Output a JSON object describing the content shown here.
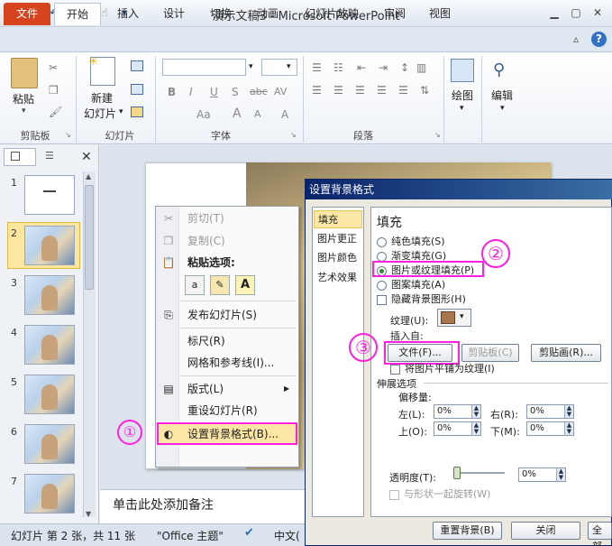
{
  "window": {
    "title": "演示文稿3 - Microsoft PowerPoint",
    "app_icon": "P"
  },
  "tabs": [
    "文件",
    "开始",
    "插入",
    "设计",
    "切换",
    "动画",
    "幻灯片放映",
    "审阅",
    "视图"
  ],
  "ribbon": {
    "groups": {
      "clipboard": "剪贴板",
      "slides": "幻灯片",
      "font": "字体",
      "paragraph": "段落"
    },
    "buttons": {
      "paste": "粘贴",
      "new_slide_1": "新建",
      "new_slide_2": "幻灯片",
      "drawing": "绘图",
      "edit": "编辑"
    },
    "font_formats": [
      "B",
      "I",
      "U",
      "S",
      "abc",
      "AV",
      "Aa",
      "A",
      "A"
    ]
  },
  "thumbnails": [
    "1",
    "2",
    "3",
    "4",
    "5",
    "6",
    "7"
  ],
  "notes": {
    "placeholder": "单击此处添加备注"
  },
  "status": {
    "slide_info": "幻灯片 第 2 张，共 11 张",
    "theme": "\"Office 主题\"",
    "language": "中文("
  },
  "context_menu": {
    "cut": "剪切(T)",
    "copy": "复制(C)",
    "paste_options": "粘贴选项:",
    "publish": "发布幻灯片(S)",
    "ruler": "标尺(R)",
    "grid": "网格和参考线(I)...",
    "layout": "版式(L)",
    "reset": "重设幻灯片(R)",
    "format_bg": "设置背景格式(B)..."
  },
  "dialog": {
    "title": "设置背景格式",
    "nav": [
      "填充",
      "图片更正",
      "图片颜色",
      "艺术效果"
    ],
    "section_title": "填充",
    "fill_options": [
      "纯色填充(S)",
      "渐变填充(G)",
      "图片或纹理填充(P)",
      "图案填充(A)"
    ],
    "selected_fill": "图片或纹理填充(P)",
    "hide_bg": "隐藏背景图形(H)",
    "texture_label": "纹理(U):",
    "insert_from": "插入自:",
    "file_btn": "文件(F)...",
    "clipboard_btn": "剪贴板(C)",
    "clipart_btn": "剪贴画(R)...",
    "tile_check": "将图片平铺为纹理(I)",
    "stretch_options": "伸展选项",
    "offsets": "偏移量:",
    "left_label": "左(L):",
    "right_label": "右(R):",
    "top_label": "上(O):",
    "bottom_label": "下(M):",
    "left_val": "0%",
    "right_val": "0%",
    "top_val": "0%",
    "bottom_val": "0%",
    "transparency_label": "透明度(T):",
    "transparency_val": "0%",
    "rotate_check": "与形状一起旋转(W)",
    "reset_btn": "重置背景(B)",
    "close_btn": "关闭",
    "apply_all_btn": "全部"
  },
  "annotations": [
    "①",
    "②",
    "③"
  ],
  "colors": {
    "accent_file_tab": "#d6441e",
    "annotation": "#ff20e0",
    "dialog_title": "#0a246a"
  }
}
